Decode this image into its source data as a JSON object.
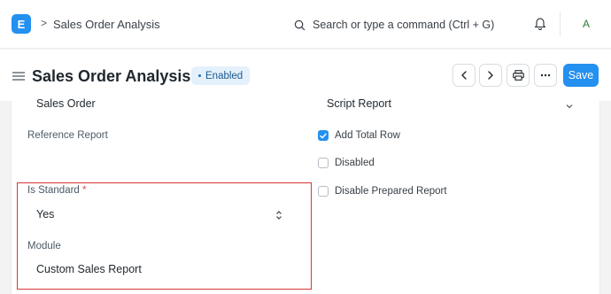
{
  "navbar": {
    "logo_letter": "E",
    "breadcrumb_sep": ">",
    "breadcrumb": "Sales Order Analysis",
    "search_placeholder": "Search or type a command (Ctrl + G)",
    "avatar_letter": "A"
  },
  "page_head": {
    "title": "Sales Order Analysis",
    "status_badge": "Enabled",
    "save_label": "Save"
  },
  "form": {
    "ref_doctype_value": "Sales Order",
    "report_type_value": "Script Report",
    "reference_report_label": "Reference Report",
    "checkboxes": [
      {
        "label": "Add Total Row",
        "checked": true
      },
      {
        "label": "Disabled",
        "checked": false
      },
      {
        "label": "Disable Prepared Report",
        "checked": false
      }
    ],
    "is_standard_label": "Is Standard",
    "required_mark": "*",
    "is_standard_value": "Yes",
    "module_label": "Module",
    "module_value": "Custom Sales Report"
  },
  "colors": {
    "accent": "#2490ef",
    "highlight_border": "#d93434",
    "badge_bg": "#e4f0fb"
  }
}
